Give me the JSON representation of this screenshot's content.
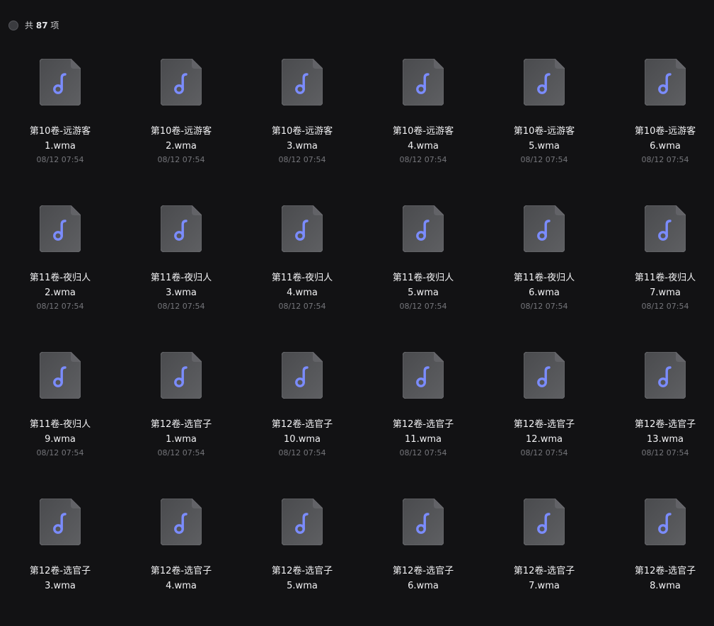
{
  "header": {
    "count_prefix": "共",
    "count_value": "87",
    "count_suffix": "项"
  },
  "colors": {
    "background": "#121214",
    "file_icon": "#56575a",
    "note_accent": "#7b8cff"
  },
  "files": [
    {
      "line1": "第10卷-远游客",
      "line2": "1.wma",
      "date": "08/12 07:54",
      "icon": "music-file-icon"
    },
    {
      "line1": "第10卷-远游客",
      "line2": "2.wma",
      "date": "08/12 07:54",
      "icon": "music-file-icon"
    },
    {
      "line1": "第10卷-远游客",
      "line2": "3.wma",
      "date": "08/12 07:54",
      "icon": "music-file-icon"
    },
    {
      "line1": "第10卷-远游客",
      "line2": "4.wma",
      "date": "08/12 07:54",
      "icon": "music-file-icon"
    },
    {
      "line1": "第10卷-远游客",
      "line2": "5.wma",
      "date": "08/12 07:54",
      "icon": "music-file-icon"
    },
    {
      "line1": "第10卷-远游客",
      "line2": "6.wma",
      "date": "08/12 07:54",
      "icon": "music-file-icon"
    },
    {
      "line1": "第11卷-夜归人",
      "line2": "2.wma",
      "date": "08/12 07:54",
      "icon": "music-file-icon"
    },
    {
      "line1": "第11卷-夜归人",
      "line2": "3.wma",
      "date": "08/12 07:54",
      "icon": "music-file-icon"
    },
    {
      "line1": "第11卷-夜归人",
      "line2": "4.wma",
      "date": "08/12 07:54",
      "icon": "music-file-icon"
    },
    {
      "line1": "第11卷-夜归人",
      "line2": "5.wma",
      "date": "08/12 07:54",
      "icon": "music-file-icon"
    },
    {
      "line1": "第11卷-夜归人",
      "line2": "6.wma",
      "date": "08/12 07:54",
      "icon": "music-file-icon"
    },
    {
      "line1": "第11卷-夜归人",
      "line2": "7.wma",
      "date": "08/12 07:54",
      "icon": "music-file-icon"
    },
    {
      "line1": "第11卷-夜归人",
      "line2": "9.wma",
      "date": "08/12 07:54",
      "icon": "music-file-icon"
    },
    {
      "line1": "第12卷-选官子",
      "line2": "1.wma",
      "date": "08/12 07:54",
      "icon": "music-file-icon"
    },
    {
      "line1": "第12卷-选官子",
      "line2": "10.wma",
      "date": "08/12 07:54",
      "icon": "music-file-icon"
    },
    {
      "line1": "第12卷-选官子",
      "line2": "11.wma",
      "date": "08/12 07:54",
      "icon": "music-file-icon"
    },
    {
      "line1": "第12卷-选官子",
      "line2": "12.wma",
      "date": "08/12 07:54",
      "icon": "music-file-icon"
    },
    {
      "line1": "第12卷-选官子",
      "line2": "13.wma",
      "date": "08/12 07:54",
      "icon": "music-file-icon"
    },
    {
      "line1": "第12卷-选官子",
      "line2": "3.wma",
      "date": "",
      "icon": "music-file-icon"
    },
    {
      "line1": "第12卷-选官子",
      "line2": "4.wma",
      "date": "",
      "icon": "music-file-icon"
    },
    {
      "line1": "第12卷-选官子",
      "line2": "5.wma",
      "date": "",
      "icon": "music-file-icon"
    },
    {
      "line1": "第12卷-选官子",
      "line2": "6.wma",
      "date": "",
      "icon": "music-file-icon"
    },
    {
      "line1": "第12卷-选官子",
      "line2": "7.wma",
      "date": "",
      "icon": "music-file-icon"
    },
    {
      "line1": "第12卷-选官子",
      "line2": "8.wma",
      "date": "",
      "icon": "music-file-icon"
    }
  ]
}
